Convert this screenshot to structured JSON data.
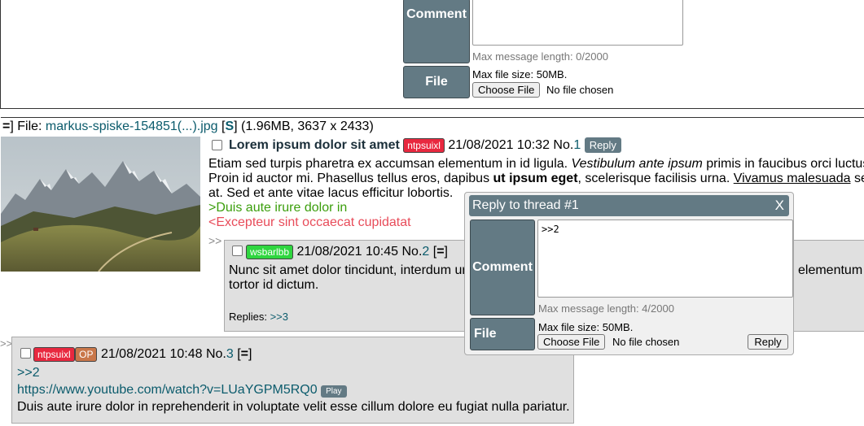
{
  "postform": {
    "comment_label": "Comment",
    "file_label": "File",
    "max_message": "Max message length: 0/2000",
    "max_file": "Max file size: 50MB.",
    "choose_file": "Choose File",
    "no_file": "No file chosen"
  },
  "op": {
    "file_prefix": "=",
    "file_word": "File:",
    "filename": "markus-spiske-154851(...).jpg",
    "s_link": "S",
    "file_meta": "(1.96MB, 3637 x 2433)",
    "subject": "Lorem ipsum dolor sit amet",
    "poster_id": "ntpsuixl",
    "datetime": "21/08/2021 10:32",
    "no_label": "No.",
    "no": "1",
    "reply_button": "Reply",
    "body_1a": "Etiam sed turpis pharetra ex accumsan elementum in id ligula. ",
    "body_1b": "Vestibulum ante ipsum",
    "body_1c": " primis in faucibus orci luctus",
    "body_2a": "Proin id auctor mi. Phasellus tellus eros, dapibus ",
    "body_2b": "ut ipsum eget",
    "body_2c": ", scelerisque facilisis urna. ",
    "body_2d": "Vivamus malesuada",
    "body_2e": " se",
    "body_3": "at. Sed et ante vitae lacus efficitur lobortis.",
    "greentext": ">Duis aute irure dolor in",
    "redtext": "<Excepteur sint occaecat cupidatat"
  },
  "post2": {
    "arrow": ">>",
    "poster_id": "wsbarlbb",
    "datetime": "21/08/2021 10:45",
    "no_label": "No.",
    "no": "2",
    "menu": "=",
    "body_line1_left": "Nunc sit amet dolor tincidunt, interdum ur",
    "body_line1_right": "elementum jus",
    "body_line2": "tortor id dictum.",
    "replies_label": "Replies:",
    "replies_link": ">>3"
  },
  "post3": {
    "arrow": ">>",
    "poster_id": "ntpsuixl",
    "op_badge": "OP",
    "datetime": "21/08/2021 10:48",
    "no_label": "No.",
    "no": "3",
    "menu": "=",
    "quote_link": ">>2",
    "url": "https://www.youtube.com/watch?v=LUaYGPM5RQ0",
    "play": "Play",
    "body": "Duis aute irure dolor in reprehenderit in voluptate velit esse cillum dolore eu fugiat nulla pariatur."
  },
  "quick_reply": {
    "title": "Reply to thread #1",
    "close": "X",
    "comment_label": "Comment",
    "comment_value": ">>2",
    "max_message": "Max message length: 4/2000",
    "file_label": "File",
    "max_file": "Max file size: 50MB.",
    "choose_file": "Choose File",
    "no_file": "No file chosen",
    "reply_button": "Reply"
  },
  "colors": {
    "label_bg": "#637a84",
    "link": "#0b5b6c",
    "greentext": "#3b9e0c",
    "redtext": "#e84c5a"
  }
}
